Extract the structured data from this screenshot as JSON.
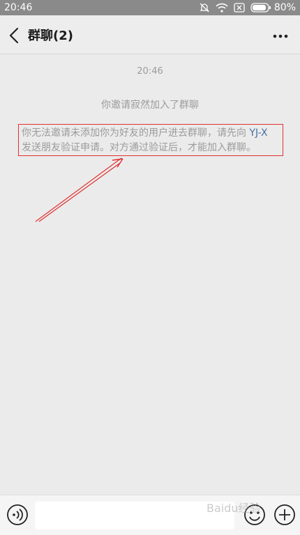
{
  "status_bar": {
    "time": "20:46",
    "battery": "80%",
    "icons": [
      "mute-bell-icon",
      "wifi-icon",
      "no-sim-icon",
      "battery-icon"
    ]
  },
  "nav": {
    "title": "群聊(2)",
    "back_icon": "chevron-left-icon",
    "more_icon": "more-dots-icon"
  },
  "chat": {
    "timestamp": "20:46",
    "system_message": "你邀请寂然加入了群聊",
    "notice": {
      "before_link": "你无法邀请未添加你为好友的用户进去群聊，请先向 ",
      "link": "YJ-X",
      "after_link": " 发送朋友验证申请。对方通过验证后，才能加入群聊。"
    },
    "annotation_color": "#e03030"
  },
  "input_bar": {
    "text_value": "",
    "icons": [
      "voice-icon",
      "emoji-icon",
      "plus-icon"
    ]
  },
  "watermark": "Baidu经验"
}
